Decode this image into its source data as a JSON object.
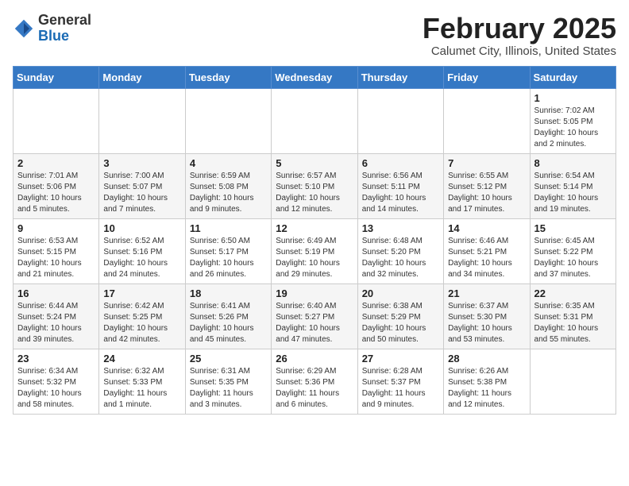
{
  "header": {
    "logo_general": "General",
    "logo_blue": "Blue",
    "month_title": "February 2025",
    "location": "Calumet City, Illinois, United States"
  },
  "days_of_week": [
    "Sunday",
    "Monday",
    "Tuesday",
    "Wednesday",
    "Thursday",
    "Friday",
    "Saturday"
  ],
  "weeks": [
    [
      {
        "day": "",
        "info": ""
      },
      {
        "day": "",
        "info": ""
      },
      {
        "day": "",
        "info": ""
      },
      {
        "day": "",
        "info": ""
      },
      {
        "day": "",
        "info": ""
      },
      {
        "day": "",
        "info": ""
      },
      {
        "day": "1",
        "info": "Sunrise: 7:02 AM\nSunset: 5:05 PM\nDaylight: 10 hours\nand 2 minutes."
      }
    ],
    [
      {
        "day": "2",
        "info": "Sunrise: 7:01 AM\nSunset: 5:06 PM\nDaylight: 10 hours\nand 5 minutes."
      },
      {
        "day": "3",
        "info": "Sunrise: 7:00 AM\nSunset: 5:07 PM\nDaylight: 10 hours\nand 7 minutes."
      },
      {
        "day": "4",
        "info": "Sunrise: 6:59 AM\nSunset: 5:08 PM\nDaylight: 10 hours\nand 9 minutes."
      },
      {
        "day": "5",
        "info": "Sunrise: 6:57 AM\nSunset: 5:10 PM\nDaylight: 10 hours\nand 12 minutes."
      },
      {
        "day": "6",
        "info": "Sunrise: 6:56 AM\nSunset: 5:11 PM\nDaylight: 10 hours\nand 14 minutes."
      },
      {
        "day": "7",
        "info": "Sunrise: 6:55 AM\nSunset: 5:12 PM\nDaylight: 10 hours\nand 17 minutes."
      },
      {
        "day": "8",
        "info": "Sunrise: 6:54 AM\nSunset: 5:14 PM\nDaylight: 10 hours\nand 19 minutes."
      }
    ],
    [
      {
        "day": "9",
        "info": "Sunrise: 6:53 AM\nSunset: 5:15 PM\nDaylight: 10 hours\nand 21 minutes."
      },
      {
        "day": "10",
        "info": "Sunrise: 6:52 AM\nSunset: 5:16 PM\nDaylight: 10 hours\nand 24 minutes."
      },
      {
        "day": "11",
        "info": "Sunrise: 6:50 AM\nSunset: 5:17 PM\nDaylight: 10 hours\nand 26 minutes."
      },
      {
        "day": "12",
        "info": "Sunrise: 6:49 AM\nSunset: 5:19 PM\nDaylight: 10 hours\nand 29 minutes."
      },
      {
        "day": "13",
        "info": "Sunrise: 6:48 AM\nSunset: 5:20 PM\nDaylight: 10 hours\nand 32 minutes."
      },
      {
        "day": "14",
        "info": "Sunrise: 6:46 AM\nSunset: 5:21 PM\nDaylight: 10 hours\nand 34 minutes."
      },
      {
        "day": "15",
        "info": "Sunrise: 6:45 AM\nSunset: 5:22 PM\nDaylight: 10 hours\nand 37 minutes."
      }
    ],
    [
      {
        "day": "16",
        "info": "Sunrise: 6:44 AM\nSunset: 5:24 PM\nDaylight: 10 hours\nand 39 minutes."
      },
      {
        "day": "17",
        "info": "Sunrise: 6:42 AM\nSunset: 5:25 PM\nDaylight: 10 hours\nand 42 minutes."
      },
      {
        "day": "18",
        "info": "Sunrise: 6:41 AM\nSunset: 5:26 PM\nDaylight: 10 hours\nand 45 minutes."
      },
      {
        "day": "19",
        "info": "Sunrise: 6:40 AM\nSunset: 5:27 PM\nDaylight: 10 hours\nand 47 minutes."
      },
      {
        "day": "20",
        "info": "Sunrise: 6:38 AM\nSunset: 5:29 PM\nDaylight: 10 hours\nand 50 minutes."
      },
      {
        "day": "21",
        "info": "Sunrise: 6:37 AM\nSunset: 5:30 PM\nDaylight: 10 hours\nand 53 minutes."
      },
      {
        "day": "22",
        "info": "Sunrise: 6:35 AM\nSunset: 5:31 PM\nDaylight: 10 hours\nand 55 minutes."
      }
    ],
    [
      {
        "day": "23",
        "info": "Sunrise: 6:34 AM\nSunset: 5:32 PM\nDaylight: 10 hours\nand 58 minutes."
      },
      {
        "day": "24",
        "info": "Sunrise: 6:32 AM\nSunset: 5:33 PM\nDaylight: 11 hours\nand 1 minute."
      },
      {
        "day": "25",
        "info": "Sunrise: 6:31 AM\nSunset: 5:35 PM\nDaylight: 11 hours\nand 3 minutes."
      },
      {
        "day": "26",
        "info": "Sunrise: 6:29 AM\nSunset: 5:36 PM\nDaylight: 11 hours\nand 6 minutes."
      },
      {
        "day": "27",
        "info": "Sunrise: 6:28 AM\nSunset: 5:37 PM\nDaylight: 11 hours\nand 9 minutes."
      },
      {
        "day": "28",
        "info": "Sunrise: 6:26 AM\nSunset: 5:38 PM\nDaylight: 11 hours\nand 12 minutes."
      },
      {
        "day": "",
        "info": ""
      }
    ]
  ]
}
